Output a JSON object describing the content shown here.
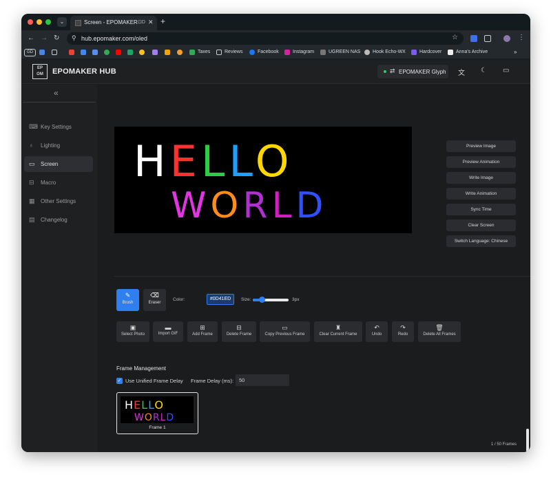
{
  "browser": {
    "tab_title": "Screen - EPOMAKER",
    "tab_memory": "⊡D",
    "url": "hub.epomaker.com/oled",
    "bookmarks": [
      "Taxes",
      "Reviews",
      "Facebook",
      "Instagram",
      "UGREEN NAS",
      "Hook Echo-WX",
      "Hardcover",
      "Anna's Archive"
    ],
    "bookmark_profile": "GD"
  },
  "app": {
    "logo_text": "EPOMAKER",
    "brand": "EPOMAKER HUB",
    "device_name": "EPOMAKER Glyph"
  },
  "sidebar": {
    "items": [
      {
        "label": "Key Settings",
        "icon": "keyboard-icon"
      },
      {
        "label": "Lighting",
        "icon": "bulb-icon"
      },
      {
        "label": "Screen",
        "icon": "monitor-icon"
      },
      {
        "label": "Macro",
        "icon": "macro-icon"
      },
      {
        "label": "Other Settings",
        "icon": "grid-icon"
      },
      {
        "label": "Changelog",
        "icon": "document-icon"
      }
    ],
    "active": "Screen"
  },
  "canvas": {
    "line1": "HELLO",
    "line2": "WORLD"
  },
  "actions": {
    "buttons": [
      "Preview Image",
      "Preview Animation",
      "Write Image",
      "Write Animation",
      "Sync Time",
      "Clear Screen",
      "Switch Language: Chinese"
    ]
  },
  "tools": {
    "brush": "Brush",
    "eraser": "Eraser",
    "color_label": "Color:",
    "color_value": "#0D41ED",
    "size_label": "Size:",
    "size_value": "3px",
    "size_fraction": 0.25
  },
  "frame_actions": [
    "Select Photo",
    "Import GIF",
    "Add Frame",
    "Delete Frame",
    "Copy Previous Frame",
    "Clear Current Frame",
    "Undo",
    "Redo",
    "Delete All Frames"
  ],
  "frames": {
    "title": "Frame Management",
    "unified_label": "Use Unified Frame Delay",
    "unified_checked": true,
    "delay_label": "Frame Delay (ms):",
    "delay_value": "50",
    "frame_label": "Frame 1",
    "count": "1 / 50 Frames"
  },
  "colors": {
    "accent": "#2f7ff0",
    "background": "#1b1c1e"
  }
}
